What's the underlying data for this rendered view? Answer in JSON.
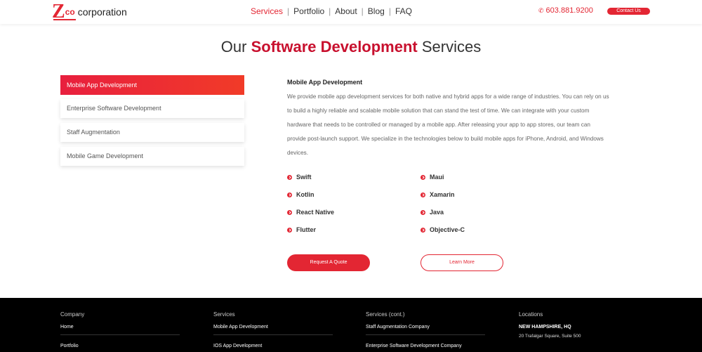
{
  "header": {
    "logo": {
      "z": "Z",
      "co": "co",
      "name": "corporation"
    },
    "nav": [
      {
        "label": "Services",
        "active": true
      },
      {
        "label": "Portfolio",
        "active": false
      },
      {
        "label": "About",
        "active": false
      },
      {
        "label": "Blog",
        "active": false
      },
      {
        "label": "FAQ",
        "active": false
      }
    ],
    "phone": "603.881.9200",
    "contact_label": "Contact Us"
  },
  "title": {
    "prefix": "Our",
    "accent": "Software Development",
    "suffix": "Services"
  },
  "tabs": [
    {
      "label": "Mobile App Development",
      "active": true
    },
    {
      "label": "Enterprise Software Development",
      "active": false
    },
    {
      "label": "Staff Augmentation",
      "active": false
    },
    {
      "label": "Mobile Game Development",
      "active": false
    }
  ],
  "content": {
    "heading": "Mobile App Development",
    "body": "We provide mobile app development services for both native and hybrid apps for a wide range of industries. You can rely on us to build a highly reliable and scalable mobile solution that can stand the test of time. We can integrate with your custom hardware that needs to be controlled or managed by a mobile app. After releasing your app to app stores, our team can provide post-launch support. We specialize in the technologies below to build mobile apps for iPhone, Android, and Windows devices."
  },
  "technologies": [
    "Swift",
    "Maui",
    "Kotlin",
    "Xamarin",
    "React Native",
    "Java",
    "Flutter",
    "Objective-C"
  ],
  "buttons": {
    "quote": "Request A Quote",
    "more": "Learn More"
  },
  "footer": {
    "company": {
      "heading": "Company",
      "links": [
        "Home",
        "Portfolio"
      ]
    },
    "services": {
      "heading": "Services",
      "links": [
        "Mobile App Development",
        "IOS App Development"
      ]
    },
    "services_cont": {
      "heading": "Services (cont.)",
      "links": [
        "Staff Augmentation Company",
        "Enterprise Software Development Company"
      ]
    },
    "locations": {
      "heading": "Locations",
      "office": "NEW HAMPSHIRE, HQ",
      "address": "20 Trafalgar Square, Suite 500"
    }
  },
  "colors": {
    "accent": "#e32633",
    "title_accent": "#c8102e",
    "footer_bg": "#000000"
  }
}
